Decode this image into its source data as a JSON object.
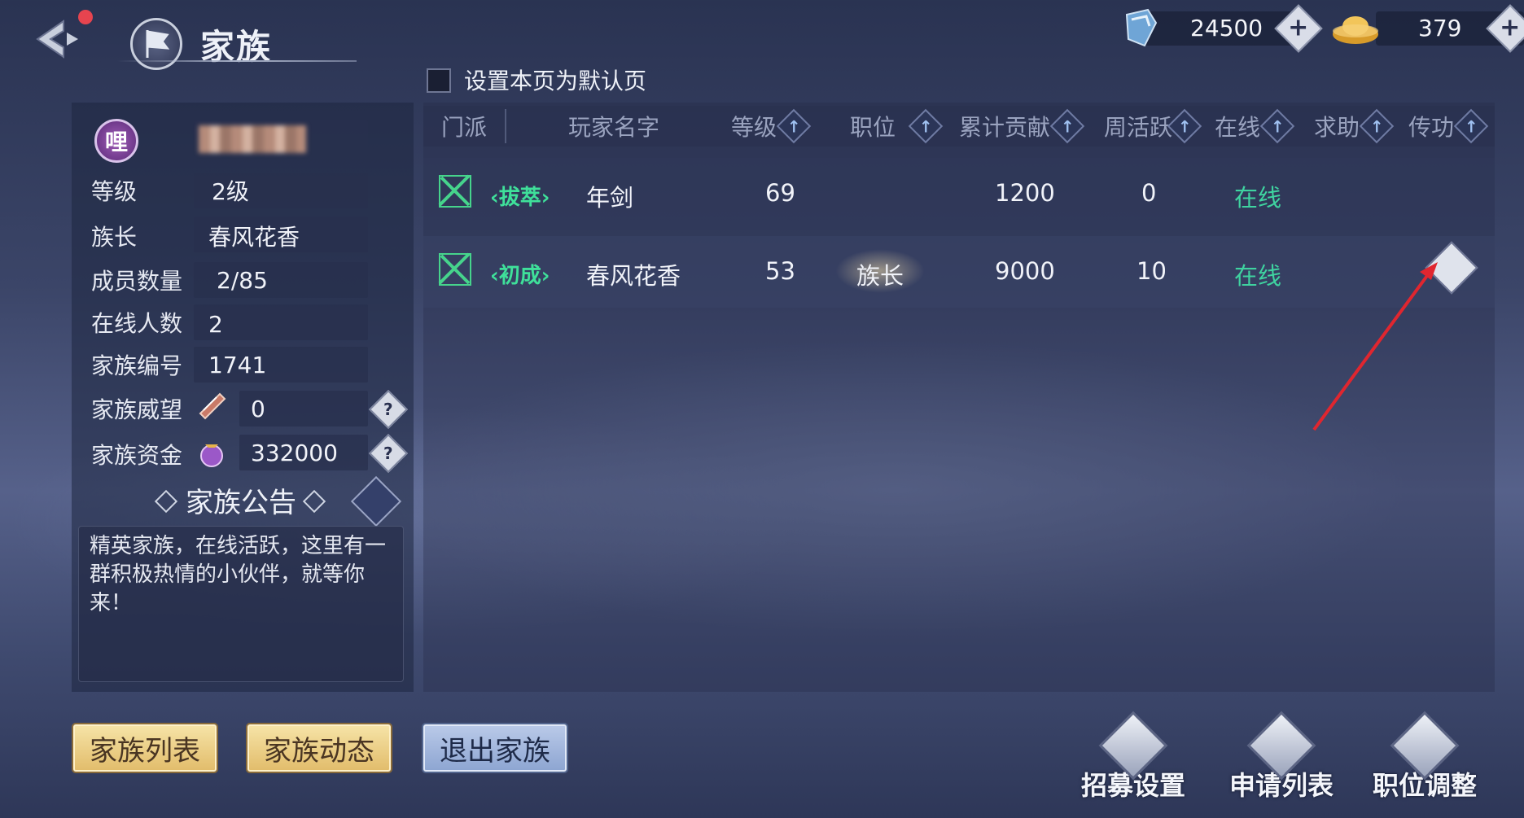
{
  "header": {
    "title": "家族",
    "currency": [
      {
        "icon": "jade-icon",
        "value": "24500"
      },
      {
        "icon": "gold-ingot-icon",
        "value": "379"
      }
    ],
    "default_page_label": "设置本页为默认页"
  },
  "family_info": {
    "avatar_char": "哩",
    "rows": [
      {
        "label": "等级",
        "value": "2级"
      },
      {
        "label": "族长",
        "value": "春风花香"
      },
      {
        "label": "成员数量",
        "value": "2/85"
      },
      {
        "label": "在线人数",
        "value": "2"
      },
      {
        "label": "家族编号",
        "value": "1741"
      },
      {
        "label": "家族威望",
        "value": "0"
      },
      {
        "label": "家族资金",
        "value": "332000"
      }
    ],
    "notice_title": "家族公告",
    "notice_text": "精英家族，在线活跃，这里有一群积极热情的小伙伴，就等你来！"
  },
  "table": {
    "headers": [
      "门派",
      "玩家名字",
      "等级",
      "职位",
      "累计贡献",
      "周活跃",
      "在线",
      "求助",
      "传功"
    ],
    "rows": [
      {
        "rank": "‹拔萃›",
        "name": "年剑",
        "level": "69",
        "position": "",
        "contribution": "1200",
        "weekly": "0",
        "online": "在线"
      },
      {
        "rank": "‹初成›",
        "name": "春风花香",
        "level": "53",
        "position": "族长",
        "contribution": "9000",
        "weekly": "10",
        "online": "在线"
      }
    ]
  },
  "bottom": {
    "buttons": [
      "家族列表",
      "家族动态",
      "退出家族"
    ],
    "functions": [
      "招募设置",
      "申请列表",
      "职位调整"
    ]
  },
  "colors": {
    "online": "#3fd3a0",
    "rank": "#3fe09a",
    "gold_button": "#e2bd6c",
    "blue_button": "#8ea6d2",
    "annotation_arrow": "#e0262f"
  }
}
